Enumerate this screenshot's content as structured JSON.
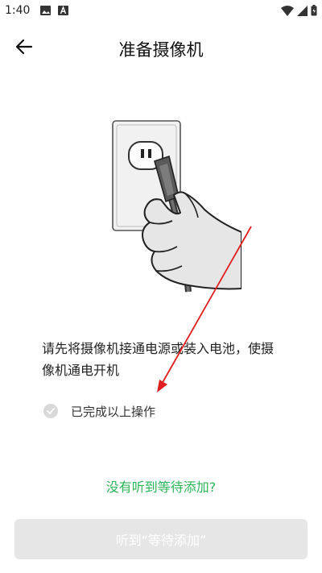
{
  "status_bar": {
    "time": "1:40",
    "icons_left": [
      "gallery-icon",
      "a-notification-icon"
    ],
    "icons_right": [
      "wifi-icon",
      "signal-icon",
      "battery-icon"
    ]
  },
  "header": {
    "back_icon": "arrow-left-icon",
    "title": "准备摄像机"
  },
  "illustration": {
    "subject": "outlet-plug-icon"
  },
  "instruction": {
    "text": "请先将摄像机接通电源或装入电池，使摄像机通电开机"
  },
  "confirm": {
    "label": "已完成以上操作",
    "checked": false
  },
  "help_link": {
    "label": "没有听到等待添加?"
  },
  "primary_button": {
    "label": "听到“等待添加”",
    "enabled": false
  },
  "colors": {
    "accent_green": "#2db55a",
    "disabled_button": "#e6e6e6",
    "annotation_arrow": "#e02020"
  }
}
